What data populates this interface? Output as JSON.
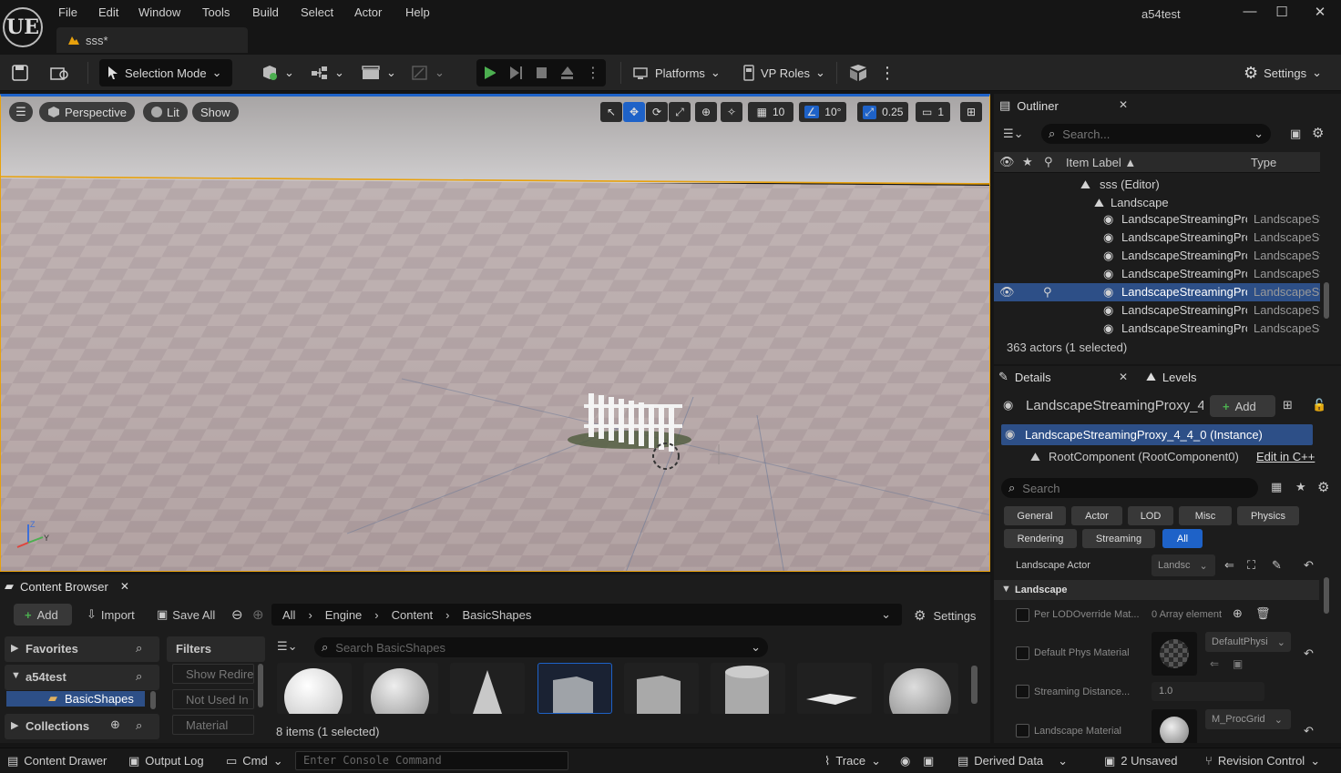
{
  "app": {
    "window_title": "a54test",
    "document_tab": "sss*",
    "logo": "UE"
  },
  "menu": [
    "File",
    "Edit",
    "Window",
    "Tools",
    "Build",
    "Select",
    "Actor",
    "Help"
  ],
  "toolbar": {
    "selection_mode": "Selection Mode",
    "platforms": "Platforms",
    "vp_roles": "VP Roles",
    "settings": "Settings"
  },
  "viewport": {
    "perspective": "Perspective",
    "lit": "Lit",
    "show": "Show",
    "grid_snap": "10",
    "rot_snap": "10°",
    "scale_snap": "0.25",
    "camera_speed": "1",
    "axis_z": "Z",
    "axis_y": "Y"
  },
  "outliner": {
    "title": "Outliner",
    "search_placeholder": "Search...",
    "col_label": "Item Label ▲",
    "col_type": "Type",
    "world": "sss (Editor)",
    "folder": "Landscape",
    "items": [
      {
        "label": "LandscapeStreamingPro",
        "type": "LandscapeSt"
      },
      {
        "label": "LandscapeStreamingPro",
        "type": "LandscapeSt"
      },
      {
        "label": "LandscapeStreamingPro",
        "type": "LandscapeSt"
      },
      {
        "label": "LandscapeStreamingPro",
        "type": "LandscapeSt"
      },
      {
        "label": "LandscapeStreamingPro",
        "type": "LandscapeSt",
        "selected": true
      },
      {
        "label": "LandscapeStreamingPro",
        "type": "LandscapeSt"
      },
      {
        "label": "LandscapeStreamingPro",
        "type": "LandscapeSt"
      }
    ],
    "status": "363 actors (1 selected)"
  },
  "details": {
    "tab": "Details",
    "tab_levels": "Levels",
    "actor_name": "LandscapeStreamingProxy_4",
    "add": "Add",
    "instance": "LandscapeStreamingProxy_4_4_0 (Instance)",
    "root": "RootComponent (RootComponent0)",
    "edit_cpp": "Edit in C++",
    "search_placeholder": "Search",
    "categories_row1": [
      "General",
      "Actor",
      "LOD",
      "Misc",
      "Physics"
    ],
    "categories_row2": [
      "Rendering",
      "Streaming",
      "All"
    ],
    "landscape_actor_label": "Landscape Actor",
    "landscape_actor_value": "Landsc",
    "section": "Landscape",
    "props": {
      "lod_override": "Per LODOverride Mat...",
      "lod_override_value": "0 Array element",
      "phys_mat": "Default Phys Material",
      "phys_mat_value": "DefaultPhysi",
      "streaming": "Streaming Distance...",
      "streaming_value": "1.0",
      "land_mat": "Landscape Material",
      "land_mat_value": "M_ProcGrid"
    }
  },
  "content_browser": {
    "title": "Content Browser",
    "add": "Add",
    "import": "Import",
    "save_all": "Save All",
    "path": [
      "All",
      "Engine",
      "Content",
      "BasicShapes"
    ],
    "settings": "Settings",
    "favorites": "Favorites",
    "project": "a54test",
    "folder": "BasicShapes",
    "collections": "Collections",
    "filters": "Filters",
    "filter_items": [
      "Show Redire",
      "Not Used In",
      "Material"
    ],
    "search_placeholder": "Search BasicShapes",
    "status": "8 items (1 selected)"
  },
  "statusbar": {
    "content_drawer": "Content Drawer",
    "output_log": "Output Log",
    "cmd": "Cmd",
    "console_placeholder": "Enter Console Command",
    "trace": "Trace",
    "derived_data": "Derived Data",
    "unsaved": "2 Unsaved",
    "revision_control": "Revision Control"
  },
  "colors": {
    "accent": "#1e62c8",
    "select_orange": "#e8a10c",
    "play_green": "#4caf50"
  }
}
